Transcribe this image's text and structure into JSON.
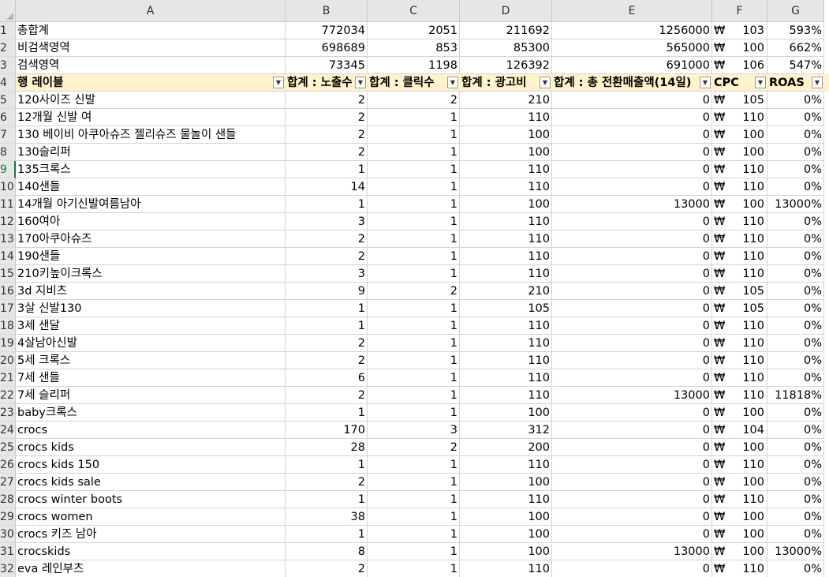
{
  "columns": [
    {
      "letter": "A",
      "width": 342
    },
    {
      "letter": "B",
      "width": 104
    },
    {
      "letter": "C",
      "width": 117
    },
    {
      "letter": "D",
      "width": 117
    },
    {
      "letter": "E",
      "width": 203
    },
    {
      "letter": "F",
      "width": 70
    },
    {
      "letter": "G",
      "width": 72
    }
  ],
  "selected_row": "9",
  "currency_symbol": "₩",
  "filter_icon": "▼",
  "header_row": {
    "row": "4",
    "labels": [
      "행 레이블",
      "합계 : 노출수",
      "합계 : 클릭수",
      "합계 : 광고비",
      "합계 : 총 전환매출액(14일)",
      "CPC",
      "ROAS"
    ]
  },
  "summary_rows": [
    {
      "row": "1",
      "label": "총합계",
      "imp": "772034",
      "clicks": "2051",
      "cost": "211692",
      "sales": "1256000",
      "cpc": "103",
      "roas": "593%"
    },
    {
      "row": "2",
      "label": "비검색영역",
      "imp": "698689",
      "clicks": "853",
      "cost": "85300",
      "sales": "565000",
      "cpc": "100",
      "roas": "662%"
    },
    {
      "row": "3",
      "label": "검색영역",
      "imp": "73345",
      "clicks": "1198",
      "cost": "126392",
      "sales": "691000",
      "cpc": "106",
      "roas": "547%"
    }
  ],
  "rows": [
    {
      "row": "5",
      "label": "120사이즈 신발",
      "imp": "2",
      "clicks": "2",
      "cost": "210",
      "sales": "0",
      "cpc": "105",
      "roas": "0%"
    },
    {
      "row": "6",
      "label": "12개월 신발 여",
      "imp": "2",
      "clicks": "1",
      "cost": "110",
      "sales": "0",
      "cpc": "110",
      "roas": "0%"
    },
    {
      "row": "7",
      "label": "130 베이비 아쿠아슈즈 젤리슈즈 물놀이 샌들",
      "imp": "2",
      "clicks": "1",
      "cost": "100",
      "sales": "0",
      "cpc": "100",
      "roas": "0%"
    },
    {
      "row": "8",
      "label": "130슬리퍼",
      "imp": "2",
      "clicks": "1",
      "cost": "100",
      "sales": "0",
      "cpc": "100",
      "roas": "0%"
    },
    {
      "row": "9",
      "label": "135크록스",
      "imp": "1",
      "clicks": "1",
      "cost": "110",
      "sales": "0",
      "cpc": "110",
      "roas": "0%"
    },
    {
      "row": "10",
      "label": "140샌들",
      "imp": "14",
      "clicks": "1",
      "cost": "110",
      "sales": "0",
      "cpc": "110",
      "roas": "0%"
    },
    {
      "row": "11",
      "label": "14개월 아기신발여름남아",
      "imp": "1",
      "clicks": "1",
      "cost": "100",
      "sales": "13000",
      "cpc": "100",
      "roas": "13000%"
    },
    {
      "row": "12",
      "label": "160여아",
      "imp": "3",
      "clicks": "1",
      "cost": "110",
      "sales": "0",
      "cpc": "110",
      "roas": "0%"
    },
    {
      "row": "13",
      "label": "170아쿠아슈즈",
      "imp": "2",
      "clicks": "1",
      "cost": "110",
      "sales": "0",
      "cpc": "110",
      "roas": "0%"
    },
    {
      "row": "14",
      "label": "190샌들",
      "imp": "2",
      "clicks": "1",
      "cost": "110",
      "sales": "0",
      "cpc": "110",
      "roas": "0%"
    },
    {
      "row": "15",
      "label": "210키높이크록스",
      "imp": "3",
      "clicks": "1",
      "cost": "110",
      "sales": "0",
      "cpc": "110",
      "roas": "0%"
    },
    {
      "row": "16",
      "label": "3d 지비츠",
      "imp": "9",
      "clicks": "2",
      "cost": "210",
      "sales": "0",
      "cpc": "105",
      "roas": "0%"
    },
    {
      "row": "17",
      "label": "3살 신발130",
      "imp": "1",
      "clicks": "1",
      "cost": "105",
      "sales": "0",
      "cpc": "105",
      "roas": "0%"
    },
    {
      "row": "18",
      "label": "3세 샌달",
      "imp": "1",
      "clicks": "1",
      "cost": "110",
      "sales": "0",
      "cpc": "110",
      "roas": "0%"
    },
    {
      "row": "19",
      "label": "4살남아신발",
      "imp": "2",
      "clicks": "1",
      "cost": "110",
      "sales": "0",
      "cpc": "110",
      "roas": "0%"
    },
    {
      "row": "20",
      "label": "5세 크록스",
      "imp": "2",
      "clicks": "1",
      "cost": "110",
      "sales": "0",
      "cpc": "110",
      "roas": "0%"
    },
    {
      "row": "21",
      "label": "7세 샌들",
      "imp": "6",
      "clicks": "1",
      "cost": "110",
      "sales": "0",
      "cpc": "110",
      "roas": "0%"
    },
    {
      "row": "22",
      "label": "7세 슬리퍼",
      "imp": "2",
      "clicks": "1",
      "cost": "110",
      "sales": "13000",
      "cpc": "110",
      "roas": "11818%"
    },
    {
      "row": "23",
      "label": "baby크록스",
      "imp": "1",
      "clicks": "1",
      "cost": "100",
      "sales": "0",
      "cpc": "100",
      "roas": "0%"
    },
    {
      "row": "24",
      "label": "crocs",
      "imp": "170",
      "clicks": "3",
      "cost": "312",
      "sales": "0",
      "cpc": "104",
      "roas": "0%"
    },
    {
      "row": "25",
      "label": "crocs kids",
      "imp": "28",
      "clicks": "2",
      "cost": "200",
      "sales": "0",
      "cpc": "100",
      "roas": "0%"
    },
    {
      "row": "26",
      "label": "crocs kids 150",
      "imp": "1",
      "clicks": "1",
      "cost": "110",
      "sales": "0",
      "cpc": "110",
      "roas": "0%"
    },
    {
      "row": "27",
      "label": "crocs kids sale",
      "imp": "2",
      "clicks": "1",
      "cost": "100",
      "sales": "0",
      "cpc": "100",
      "roas": "0%"
    },
    {
      "row": "28",
      "label": "crocs winter boots",
      "imp": "1",
      "clicks": "1",
      "cost": "110",
      "sales": "0",
      "cpc": "110",
      "roas": "0%"
    },
    {
      "row": "29",
      "label": "crocs women",
      "imp": "38",
      "clicks": "1",
      "cost": "100",
      "sales": "0",
      "cpc": "100",
      "roas": "0%"
    },
    {
      "row": "30",
      "label": "crocs 키즈 남아",
      "imp": "1",
      "clicks": "1",
      "cost": "100",
      "sales": "0",
      "cpc": "100",
      "roas": "0%"
    },
    {
      "row": "31",
      "label": "crocskids",
      "imp": "8",
      "clicks": "1",
      "cost": "100",
      "sales": "13000",
      "cpc": "100",
      "roas": "13000%"
    },
    {
      "row": "32",
      "label": "eva 레인부츠",
      "imp": "2",
      "clicks": "1",
      "cost": "110",
      "sales": "0",
      "cpc": "110",
      "roas": "0%"
    }
  ]
}
